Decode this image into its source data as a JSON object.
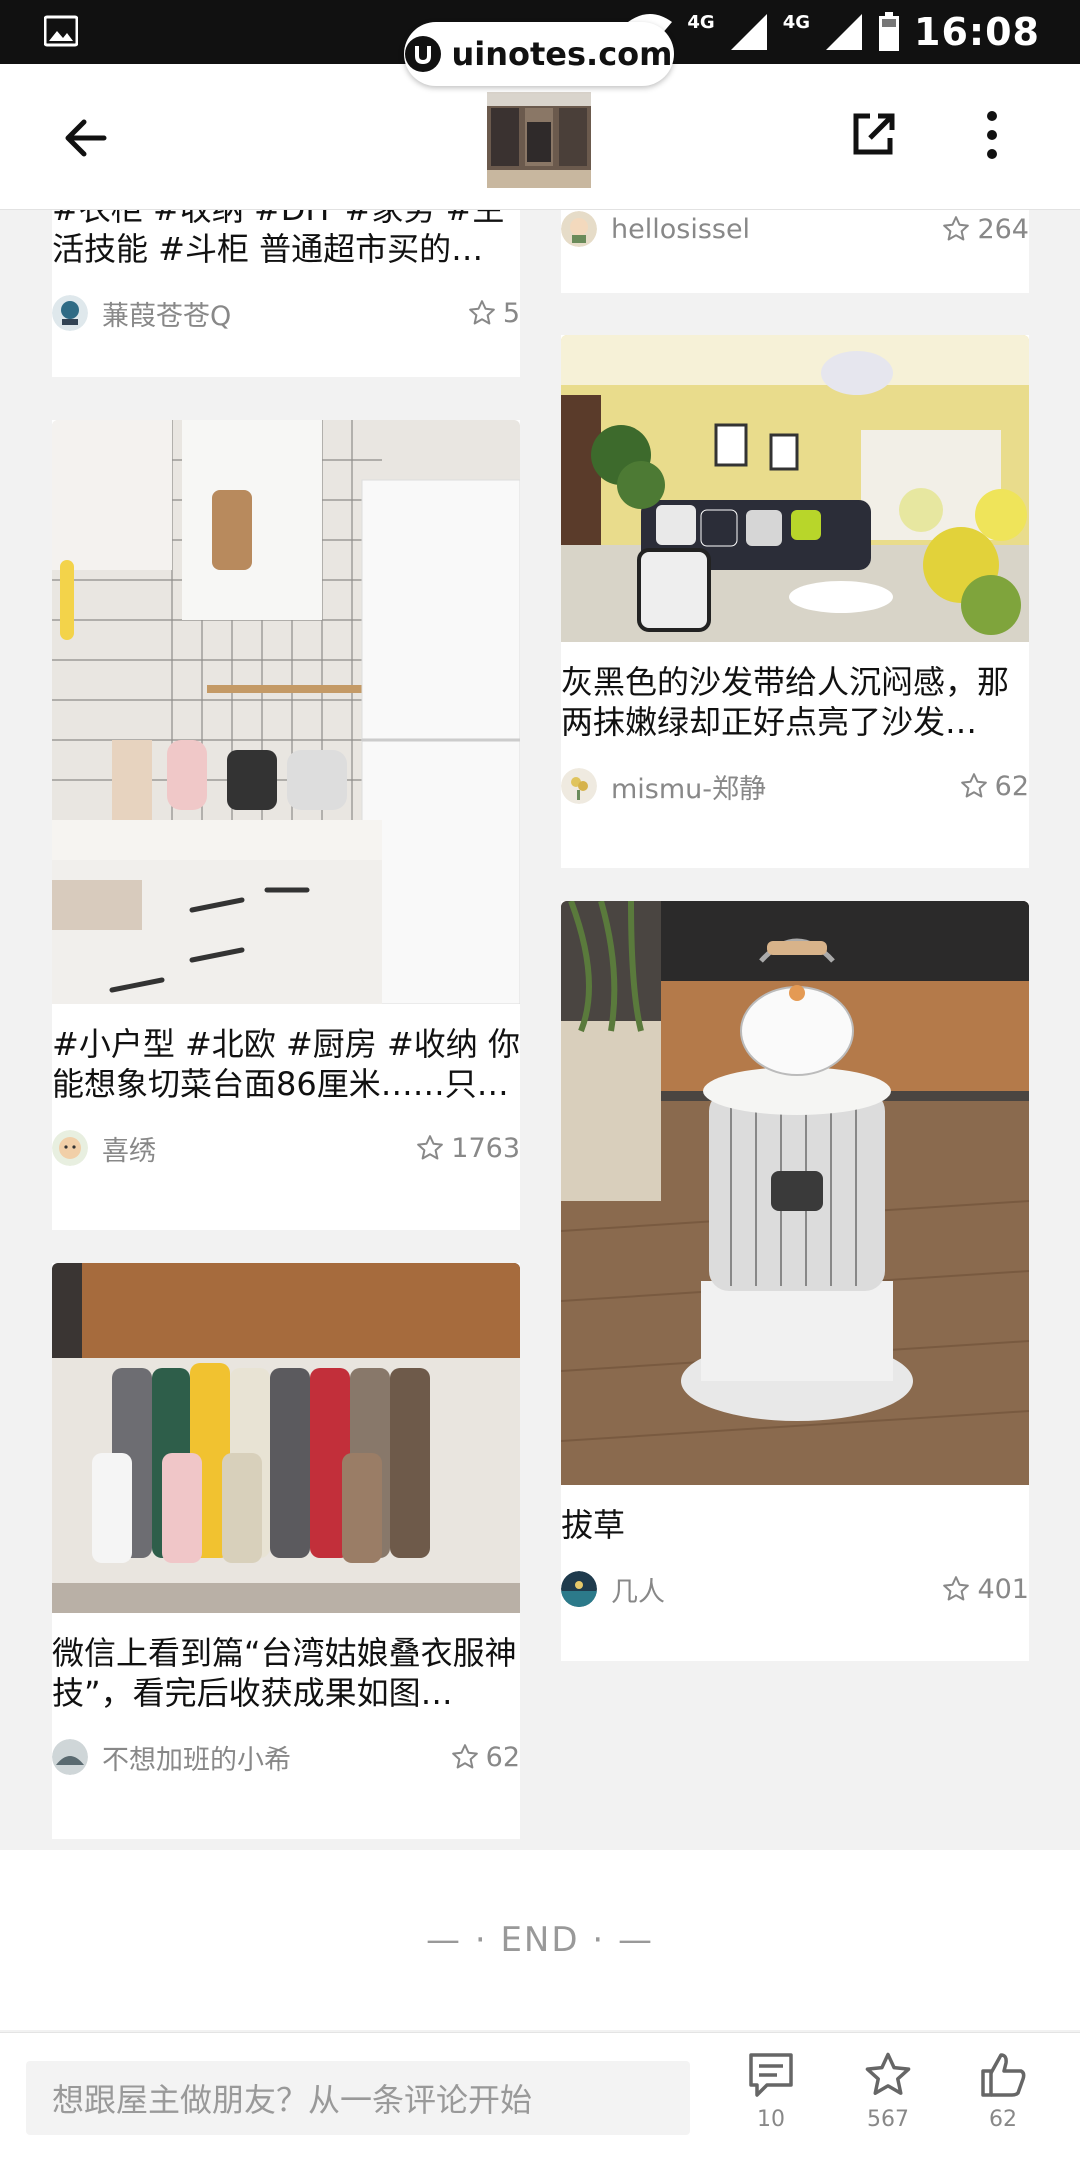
{
  "status_bar": {
    "time": "16:08",
    "network_1": "4G",
    "network_2": "4G"
  },
  "watermark": {
    "text": "uinotes.com"
  },
  "header": {
    "back_icon": "arrow-left-icon",
    "share_icon": "share-external-icon",
    "more_icon": "more-vertical-icon"
  },
  "left_column": [
    {
      "title": "#衣柜 #收纳 #DIY #家务 #生活技能 #斗柜  普通超市买的…",
      "user": "蒹葭苍苍Q",
      "likes": "5"
    },
    {
      "title": "#小户型 #北欧 #厨房 #收纳 你能想象切菜台面86厘米……只…",
      "user": "喜绣",
      "likes": "1763"
    },
    {
      "title": "微信上看到篇“台湾姑娘叠衣服神技”，看完后收获成果如图…",
      "user": "不想加班的小希",
      "likes": "62"
    }
  ],
  "right_column": [
    {
      "user": "hellosissel",
      "likes": "264"
    },
    {
      "title": "灰黑色的沙发带给人沉闷感，那两抹嫩绿却正好点亮了沙发…",
      "user": "mismu-郑静",
      "likes": "62"
    },
    {
      "title": "拔草",
      "user": "几人",
      "likes": "401"
    }
  ],
  "end_text": "— · END · —",
  "bottom_bar": {
    "comment_placeholder": "想跟屋主做朋友？从一条评论开始",
    "comments_count": "10",
    "favorites_count": "567",
    "likes_count": "62"
  },
  "colors": {
    "background": "#f2f2f2",
    "card": "#ffffff",
    "muted_text": "#888888",
    "status_bar": "#111111"
  }
}
